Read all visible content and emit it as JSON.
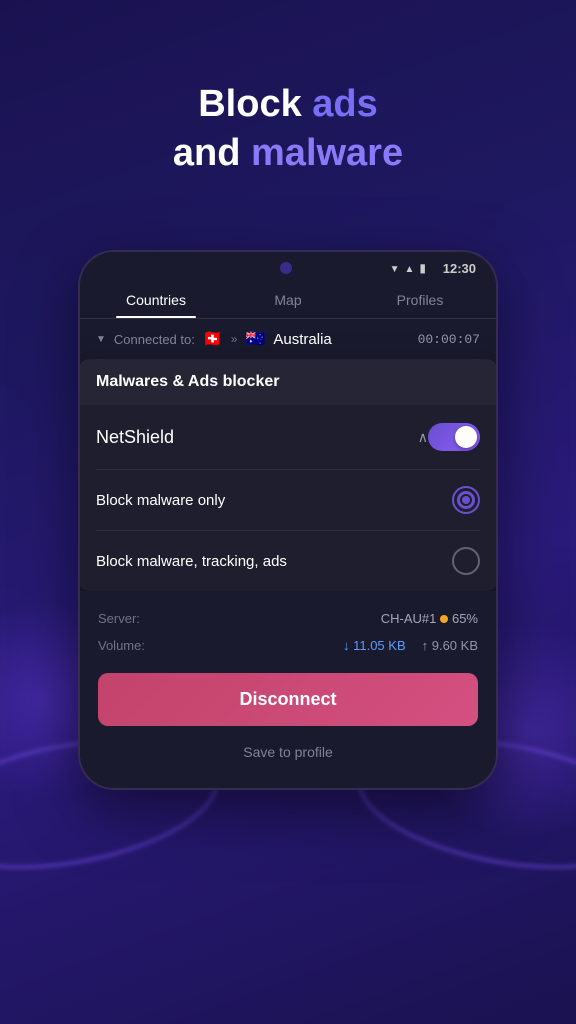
{
  "header": {
    "line1_prefix": "Block ",
    "line1_accent": "ads",
    "line2_prefix": "and ",
    "line2_accent": "malware"
  },
  "statusBar": {
    "time": "12:30"
  },
  "tabs": [
    {
      "label": "Countries",
      "active": true
    },
    {
      "label": "Map",
      "active": false
    },
    {
      "label": "Profiles",
      "active": false
    }
  ],
  "connection": {
    "label": "Connected to:",
    "from_flag": "🇨🇭",
    "to_flag": "🇦🇺",
    "country": "Australia",
    "timer": "00:00:07"
  },
  "popup": {
    "title": "Malwares & Ads blocker",
    "netshield_label": "NetShield",
    "toggle_on": true,
    "options": [
      {
        "label": "Block malware only",
        "selected": true
      },
      {
        "label": "Block malware, tracking, ads",
        "selected": false
      }
    ]
  },
  "server": {
    "server_label": "Server:",
    "server_value": "CH-AU#1",
    "load_pct": "65%",
    "volume_label": "Volume:",
    "vol_down": "↓  11.05 KB",
    "vol_up": "↑  9.60 KB"
  },
  "actions": {
    "disconnect_label": "Disconnect",
    "save_profile_label": "Save to profile"
  }
}
